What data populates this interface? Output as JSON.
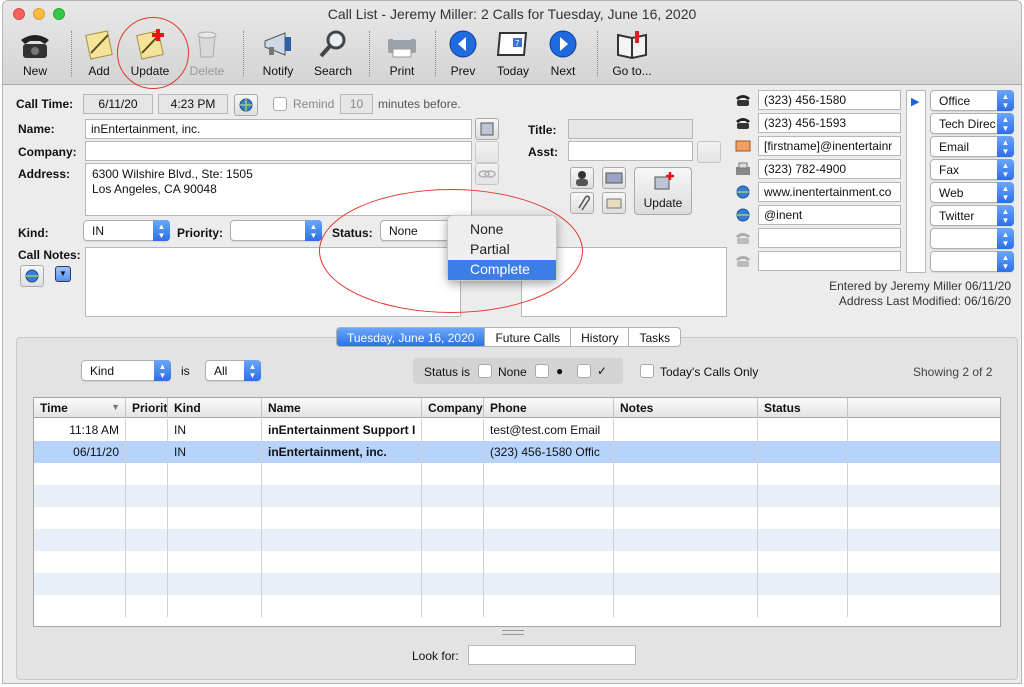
{
  "window": {
    "title": "Call List - Jeremy Miller: 2 Calls for Tuesday, June 16, 2020"
  },
  "toolbar": {
    "buttons": [
      {
        "label": "New",
        "icon": "telephone-icon"
      },
      {
        "label": "Add",
        "icon": "notepad-add-icon"
      },
      {
        "label": "Update",
        "icon": "notepad-update-icon"
      },
      {
        "label": "Delete",
        "icon": "trash-icon"
      },
      {
        "label": "Notify",
        "icon": "megaphone-icon"
      },
      {
        "label": "Search",
        "icon": "magnifier-icon"
      },
      {
        "label": "Print",
        "icon": "printer-icon"
      },
      {
        "label": "Prev",
        "icon": "arrow-left-icon"
      },
      {
        "label": "Today",
        "icon": "calendar-icon"
      },
      {
        "label": "Next",
        "icon": "arrow-right-icon"
      },
      {
        "label": "Go to...",
        "icon": "book-icon"
      }
    ]
  },
  "form": {
    "call_time_label": "Call Time:",
    "call_date": "6/11/20",
    "call_time": "4:23 PM",
    "remind_label": "Remind",
    "remind_minutes": "10",
    "remind_suffix": "minutes before.",
    "name_label": "Name:",
    "name_value": "inEntertainment, inc.",
    "company_label": "Company:",
    "company_value": "",
    "address_label": "Address:",
    "address_line1": "6300 Wilshire Blvd., Ste: 1505",
    "address_line2": "Los Angeles, CA  90048",
    "title_label": "Title:",
    "asst_label": "Asst:",
    "kind_label": "Kind:",
    "kind_value": "IN",
    "priority_label": "Priority:",
    "priority_value": "",
    "status_label": "Status:",
    "status_value": "None",
    "notes_label": "Call Notes:",
    "update_button": "Update"
  },
  "status_menu": {
    "options": [
      "None",
      "Partial",
      "Complete"
    ],
    "selected": "Complete"
  },
  "contacts": [
    {
      "value": "(323) 456-1580",
      "type": "Office",
      "icon": "phone-icon"
    },
    {
      "value": "(323) 456-1593",
      "type": "Tech Direc",
      "icon": "phone-icon"
    },
    {
      "value": "[firstname]@inentertainr",
      "type": "Email",
      "icon": "envelope-icon"
    },
    {
      "value": "(323) 782-4900",
      "type": "Fax",
      "icon": "fax-icon"
    },
    {
      "value": "www.inentertainment.co",
      "type": "Web",
      "icon": "globe-icon"
    },
    {
      "value": "@inent",
      "type": "Twitter",
      "icon": "globe-icon"
    },
    {
      "value": "",
      "type": "",
      "icon": "phone-icon"
    },
    {
      "value": "",
      "type": "",
      "icon": "phone-icon"
    }
  ],
  "entered_by": "Entered by  Jeremy Miller 06/11/20",
  "address_modified": "Address Last Modified: 06/16/20",
  "tabs": [
    {
      "label": "Tuesday, June 16, 2020",
      "active": true
    },
    {
      "label": "Future Calls",
      "active": false
    },
    {
      "label": "History",
      "active": false
    },
    {
      "label": "Tasks",
      "active": false
    }
  ],
  "filter": {
    "kind_field": "Kind",
    "is_label": "is",
    "kind_value": "All",
    "status_is_label": "Status is",
    "status_none_label": "None",
    "status_dot": "●",
    "status_check": "✓",
    "todays_only_label": "Today's Calls Only",
    "showing": "Showing 2 of 2"
  },
  "table": {
    "columns": [
      "Time",
      "Priorit",
      "Kind",
      "Name",
      "Company",
      "Phone",
      "Notes",
      "Status"
    ],
    "rows": [
      {
        "time": "11:18 AM",
        "priority": "",
        "kind": "IN",
        "name": "inEntertainment Support I",
        "company": "",
        "phone": "test@test.com Email",
        "notes": "",
        "status": ""
      },
      {
        "time": "06/11/20",
        "priority": "",
        "kind": "IN",
        "name": "inEntertainment, inc.",
        "company": "",
        "phone": "(323) 456-1580 Offic",
        "notes": "",
        "status": ""
      }
    ]
  },
  "look_for_label": "Look for:",
  "colors": {
    "accent": "#2c6fe6",
    "selection": "#b5d3fb",
    "annotation": "#e0392b",
    "alt_row": "#e8eff9"
  }
}
